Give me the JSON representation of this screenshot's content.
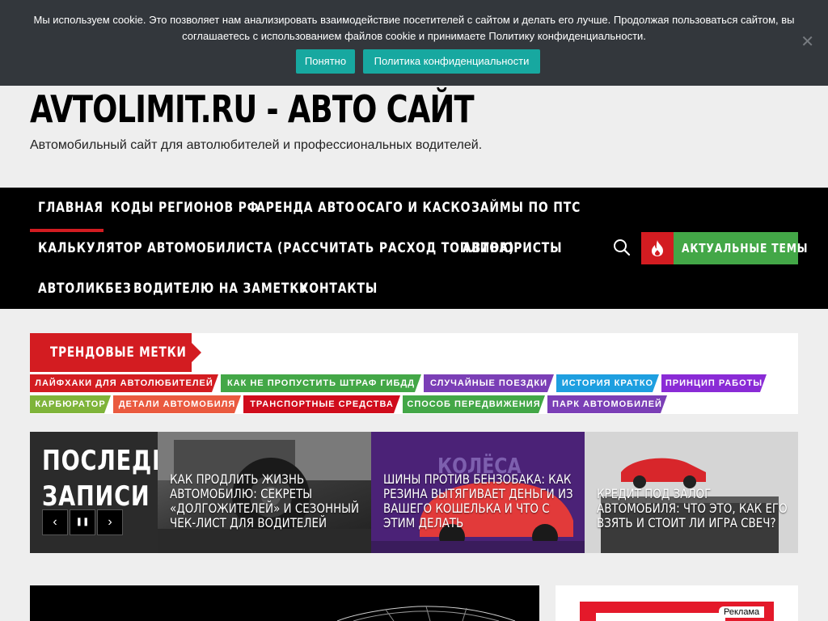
{
  "cookie": {
    "text": "Мы используем cookie. Это позволяет нам анализировать взаимодействие посетителей с сайтом и делать его лучше. Продолжая пользоваться сайтом, вы соглашаетесь с использованием файлов cookie и принимаете Политику конфиденциальности.",
    "ok_label": "Понятно",
    "policy_label": "Политика конфиденциальности",
    "close_glyph": "✕"
  },
  "header": {
    "title": "AVTOLIMIT.RU - АВТО САЙТ",
    "description": "Автомобильный сайт для автолюбителей и профессиональных водителей."
  },
  "nav": {
    "items": [
      {
        "label": "ГЛАВНАЯ"
      },
      {
        "label": "КОДЫ РЕГИОНОВ РФ"
      },
      {
        "label": "АРЕНДА АВТО"
      },
      {
        "label": "ОСАГО И КАСКО"
      },
      {
        "label": "ЗАЙМЫ ПО ПТС"
      },
      {
        "label": "КАЛЬКУЛЯТОР АВТОМОБИЛИСТА (РАССЧИТАТЬ РАСХОД ТОПЛИВА)"
      },
      {
        "label": "АВТОЮРИСТЫ"
      },
      {
        "label": "АВТОЛИКБЕЗ"
      },
      {
        "label": "ВОДИТЕЛЮ НА ЗАМЕТКУ"
      },
      {
        "label": "КОНТАКТЫ"
      }
    ],
    "hot_label": "АКТУАЛЬНЫЕ ТЕМЫ",
    "search_icon": "search-icon",
    "fire_icon": "fire-icon"
  },
  "trending": {
    "heading": "ТРЕНДОВЫЕ МЕТКИ",
    "tags": [
      {
        "label": "ЛАЙФХАКИ ДЛЯ АВТОЛЮБИТЕЛЕЙ",
        "color": "#d31c21"
      },
      {
        "label": "КАК НЕ ПРОПУСТИТЬ ШТРАФ ГИБДД",
        "color": "#43a747"
      },
      {
        "label": "СЛУЧАЙНЫЕ ПОЕЗДКИ",
        "color": "#7b3fb6"
      },
      {
        "label": "ИСТОРИЯ КРАТКО",
        "color": "#1e9fe0"
      },
      {
        "label": "ПРИНЦИП РАБОТЫ",
        "color": "#8a2bd6"
      },
      {
        "label": "КАРБЮРАТОР",
        "color": "#7fb43a"
      },
      {
        "label": "ДЕТАЛИ АВТОМОБИЛЯ",
        "color": "#ea5a3f"
      },
      {
        "label": "ТРАНСПОРТНЫЕ СРЕДСТВА",
        "color": "#d00c1c"
      },
      {
        "label": "СПОСОБ ПЕРЕДВИЖЕНИЯ",
        "color": "#43a747"
      },
      {
        "label": "ПАРК АВТОМОБИЛЕЙ",
        "color": "#7b3fb6"
      }
    ]
  },
  "latest": {
    "title_line1": "ПОСЛЕДНИЕ",
    "title_line2": "ЗАПИСИ",
    "prev_glyph": "‹",
    "pause_glyph": "❚❚",
    "next_glyph": "›",
    "posts": [
      {
        "title": "КАК ПРОДЛИТЬ ЖИЗНЬ АВТОМОБИЛЮ: СЕКРЕТЫ «ДОЛГОЖИТЕЛЕЙ» И СЕЗОННЫЙ ЧЕК-ЛИСТ ДЛЯ ВОДИТЕЛЕЙ"
      },
      {
        "title": "ШИНЫ ПРОТИВ БЕНЗОБАКА: КАК РЕЗИНА ВЫТЯГИВАЕТ ДЕНЬГИ ИЗ ВАШЕГО КОШЕЛЬКА И ЧТО С ЭТИМ ДЕЛАТЬ",
        "image_text": "КОЛЁСА"
      },
      {
        "title": "КРЕДИТ ПОД ЗАЛОГ АВТОМОБИЛЯ: ЧТО ЭТО, КАК ЕГО ВЗЯТЬ И СТОИТ ЛИ ИГРА СВЕЧ?"
      }
    ]
  },
  "ad": {
    "badge": "Реклама"
  }
}
